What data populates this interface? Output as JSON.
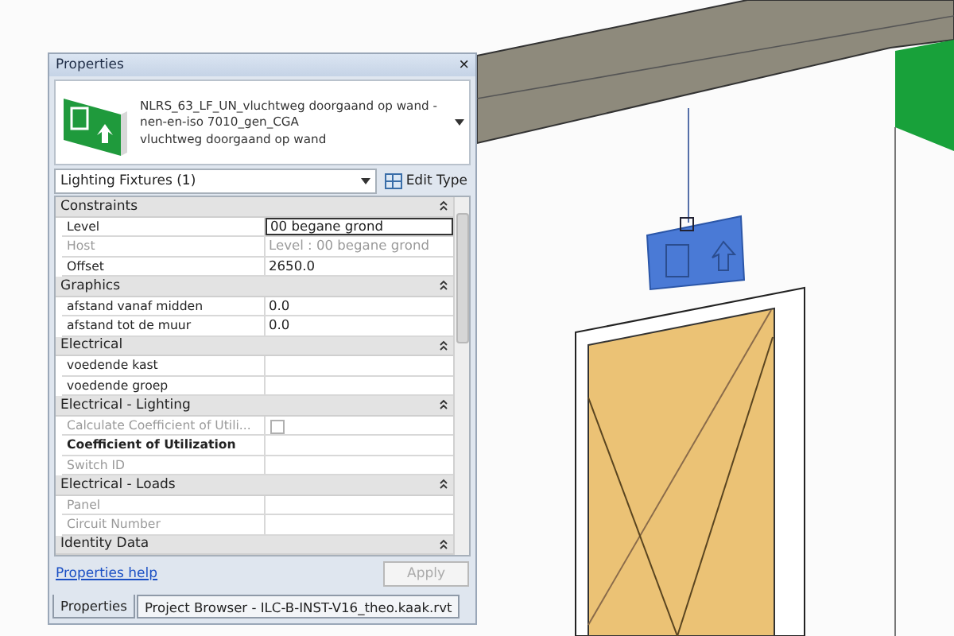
{
  "panel": {
    "title": "Properties",
    "close": "×",
    "type_selector": {
      "name": "NLRS_63_LF_UN_vluchtweg doorgaand op wand - nen-en-iso 7010_gen_CGA",
      "subtitle": "vluchtweg doorgaand op wand"
    },
    "category": "Lighting Fixtures (1)",
    "edit_type": "Edit Type",
    "rows": [
      {
        "kind": "group",
        "label": "Constraints",
        "expanded": true
      },
      {
        "kind": "param",
        "label": "Level",
        "value": "00 begane grond",
        "disabled": false,
        "focused": true,
        "bold": false
      },
      {
        "kind": "param",
        "label": "Host",
        "value": "Level : 00 begane grond",
        "disabled": true,
        "focused": false,
        "bold": false
      },
      {
        "kind": "param",
        "label": "Offset",
        "value": "2650.0",
        "disabled": false,
        "focused": false,
        "bold": false
      },
      {
        "kind": "group",
        "label": "Graphics",
        "expanded": true
      },
      {
        "kind": "param",
        "label": "afstand vanaf midden",
        "value": "0.0",
        "disabled": false,
        "focused": false,
        "bold": false
      },
      {
        "kind": "param",
        "label": "afstand tot de muur",
        "value": "0.0",
        "disabled": false,
        "focused": false,
        "bold": false
      },
      {
        "kind": "group",
        "label": "Electrical",
        "expanded": true
      },
      {
        "kind": "param",
        "label": "voedende kast",
        "value": "",
        "disabled": false,
        "focused": false,
        "bold": false
      },
      {
        "kind": "param",
        "label": "voedende groep",
        "value": "",
        "disabled": false,
        "focused": false,
        "bold": false
      },
      {
        "kind": "group",
        "label": "Electrical - Lighting",
        "expanded": true
      },
      {
        "kind": "checkbox",
        "label": "Calculate Coefficient of Utili...",
        "checked": false,
        "disabled": true
      },
      {
        "kind": "param",
        "label": "Coefficient of Utilization",
        "value": "",
        "disabled": false,
        "focused": false,
        "bold": true
      },
      {
        "kind": "param",
        "label": "Switch ID",
        "value": "",
        "disabled": true,
        "focused": false,
        "bold": false
      },
      {
        "kind": "group",
        "label": "Electrical - Loads",
        "expanded": true
      },
      {
        "kind": "param",
        "label": "Panel",
        "value": "",
        "disabled": true,
        "focused": false,
        "bold": false
      },
      {
        "kind": "param",
        "label": "Circuit Number",
        "value": "",
        "disabled": true,
        "focused": false,
        "bold": false
      },
      {
        "kind": "group",
        "label": "Identity Data",
        "expanded": true
      }
    ],
    "help_link": "Properties help",
    "apply": {
      "label": "Apply",
      "disabled": true
    },
    "tabs": [
      {
        "label": "Properties",
        "selected": true
      },
      {
        "label": "Project Browser - ILC-B-INST-V16_theo.kaak.rvt",
        "selected": false
      }
    ]
  }
}
